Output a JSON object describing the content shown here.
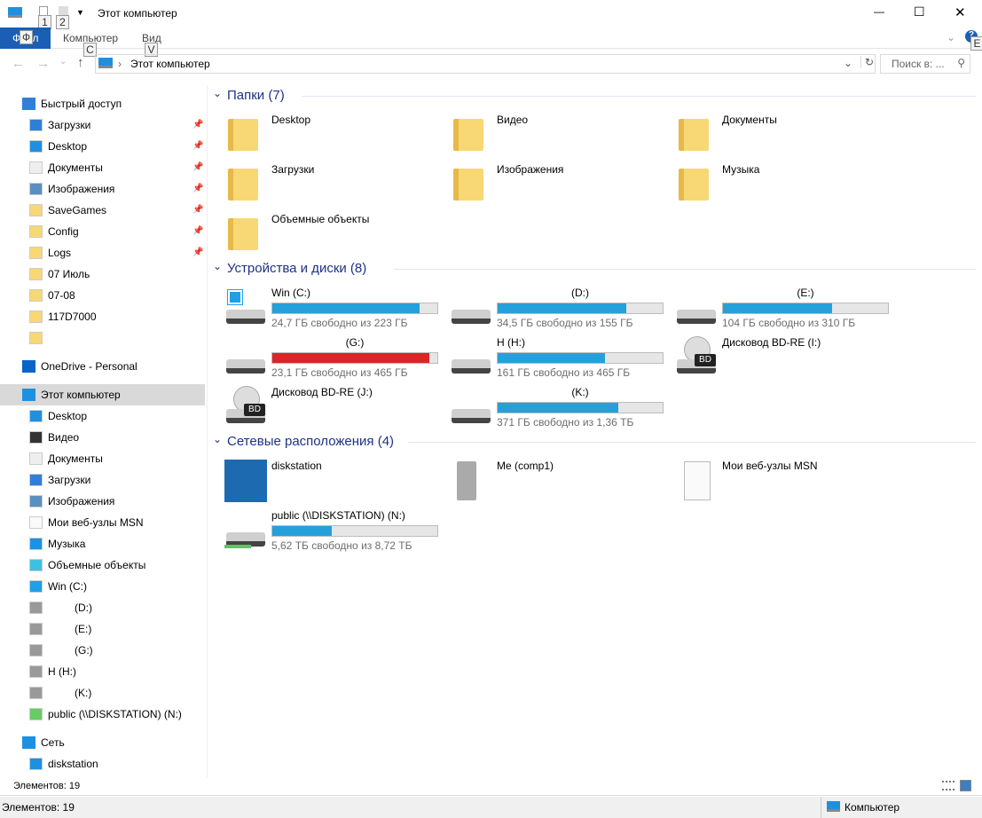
{
  "window": {
    "title": "Этот компьютер",
    "keytips": [
      "1",
      "2"
    ],
    "minimize": "—",
    "maximize": "☐",
    "close": "✕"
  },
  "ribbon": {
    "tabs": [
      {
        "label": "Файл",
        "keytip": "Ф"
      },
      {
        "label": "Компьютер",
        "keytip": "C"
      },
      {
        "label": "Вид",
        "keytip": "V"
      }
    ],
    "help_keytip": "E"
  },
  "nav": {
    "address_path": "Этот компьютер",
    "search_placeholder": "Поиск в: ..."
  },
  "sidebar": {
    "sections": [
      {
        "header": "Быстрый доступ",
        "icon": "star-icon",
        "items": [
          {
            "label": "Загрузки",
            "icon": "download-icon",
            "pinned": true
          },
          {
            "label": "Desktop",
            "icon": "desktop-icon",
            "pinned": true
          },
          {
            "label": "Документы",
            "icon": "document-icon",
            "pinned": true
          },
          {
            "label": "Изображения",
            "icon": "image-icon",
            "pinned": true
          },
          {
            "label": "SaveGames",
            "icon": "folder-icon",
            "pinned": true
          },
          {
            "label": "Config",
            "icon": "folder-icon",
            "pinned": true
          },
          {
            "label": "Logs",
            "icon": "folder-icon",
            "pinned": true
          },
          {
            "label": "07 Июль",
            "icon": "folder-icon"
          },
          {
            "label": "07-08",
            "icon": "folder-icon"
          },
          {
            "label": "117D7000",
            "icon": "folder-icon"
          },
          {
            "label": "",
            "icon": "folder-icon"
          }
        ]
      },
      {
        "header": "OneDrive - Personal",
        "icon": "cloud-icon",
        "items": []
      },
      {
        "header": "Этот компьютер",
        "icon": "computer-icon",
        "selected": true,
        "items": [
          {
            "label": "Desktop",
            "icon": "desktop-icon"
          },
          {
            "label": "Видео",
            "icon": "video-icon"
          },
          {
            "label": "Документы",
            "icon": "document-icon"
          },
          {
            "label": "Загрузки",
            "icon": "download-icon"
          },
          {
            "label": "Изображения",
            "icon": "image-icon"
          },
          {
            "label": "Мои веб-узлы MSN",
            "icon": "file-icon"
          },
          {
            "label": "Музыка",
            "icon": "music-icon"
          },
          {
            "label": "Объемные объекты",
            "icon": "cube-icon"
          },
          {
            "label": "Win (C:)",
            "icon": "windows-drive-icon"
          },
          {
            "label": "(D:)",
            "icon": "drive-icon",
            "indent": true
          },
          {
            "label": "(E:)",
            "icon": "drive-icon",
            "indent": true
          },
          {
            "label": "(G:)",
            "icon": "shared-drive-icon",
            "indent": true
          },
          {
            "label": "H (H:)",
            "icon": "drive-icon"
          },
          {
            "label": "(K:)",
            "icon": "drive-icon",
            "indent": true
          },
          {
            "label": "public (\\\\DISKSTATION) (N:)",
            "icon": "network-drive-icon"
          }
        ]
      },
      {
        "header": "Сеть",
        "icon": "network-icon",
        "items": [
          {
            "label": "diskstation",
            "icon": "computer-icon"
          }
        ]
      }
    ]
  },
  "content": {
    "groups": [
      {
        "title": "Папки (7)",
        "items": [
          {
            "name": "Desktop",
            "icon": "desktop-folder-icon"
          },
          {
            "name": "Видео",
            "icon": "video-folder-icon"
          },
          {
            "name": "Документы",
            "icon": "documents-folder-icon"
          },
          {
            "name": "Загрузки",
            "icon": "downloads-folder-icon"
          },
          {
            "name": "Изображения",
            "icon": "pictures-folder-icon"
          },
          {
            "name": "Музыка",
            "icon": "music-folder-icon"
          },
          {
            "name": "Объемные объекты",
            "icon": "3d-objects-folder-icon"
          }
        ]
      },
      {
        "title": "Устройства и диски (8)",
        "items": [
          {
            "name": "Win (C:)",
            "icon": "windows-drive-icon",
            "free_text": "24,7 ГБ свободно из 223 ГБ",
            "used_fraction": 0.89
          },
          {
            "name": "(D:)",
            "icon": "drive-icon",
            "free_text": "34,5 ГБ свободно из 155 ГБ",
            "used_fraction": 0.78,
            "center": true
          },
          {
            "name": "(E:)",
            "icon": "drive-icon",
            "free_text": "104 ГБ свободно из 310 ГБ",
            "used_fraction": 0.66,
            "center": true
          },
          {
            "name": "(G:)",
            "icon": "shared-drive-icon",
            "free_text": "23,1 ГБ свободно из 465 ГБ",
            "used_fraction": 0.95,
            "critical": true,
            "center": true
          },
          {
            "name": "H (H:)",
            "icon": "drive-icon",
            "free_text": "161 ГБ свободно из 465 ГБ",
            "used_fraction": 0.65
          },
          {
            "name": "Дисковод BD-RE (I:)",
            "icon": "bd-drive-icon"
          },
          {
            "name": "Дисковод BD-RE (J:)",
            "icon": "shared-bd-drive-icon"
          },
          {
            "name": "(K:)",
            "icon": "drive-icon",
            "free_text": "371 ГБ свободно из 1,36 ТБ",
            "used_fraction": 0.73,
            "center": true
          }
        ]
      },
      {
        "title": "Сетевые расположения (4)",
        "items": [
          {
            "name": "diskstation",
            "icon": "synology-icon"
          },
          {
            "name": "Me (comp1)",
            "icon": "media-server-icon"
          },
          {
            "name": "Мои веб-узлы MSN",
            "icon": "file-icon"
          },
          {
            "name": "public (\\\\DISKSTATION) (N:)",
            "icon": "network-drive-icon",
            "free_text": "5,62 ТБ свободно из 8,72 ТБ",
            "used_fraction": 0.36
          }
        ]
      }
    ]
  },
  "status": {
    "inner": "Элементов: 19",
    "bar_left": "Элементов: 19",
    "bar_right": "Компьютер"
  },
  "colors": {
    "accent": "#1a5fb4",
    "bar": "#26a0da",
    "bar_critical": "#da2626",
    "group_header": "#1e3287",
    "selection": "#d9d9d9"
  }
}
